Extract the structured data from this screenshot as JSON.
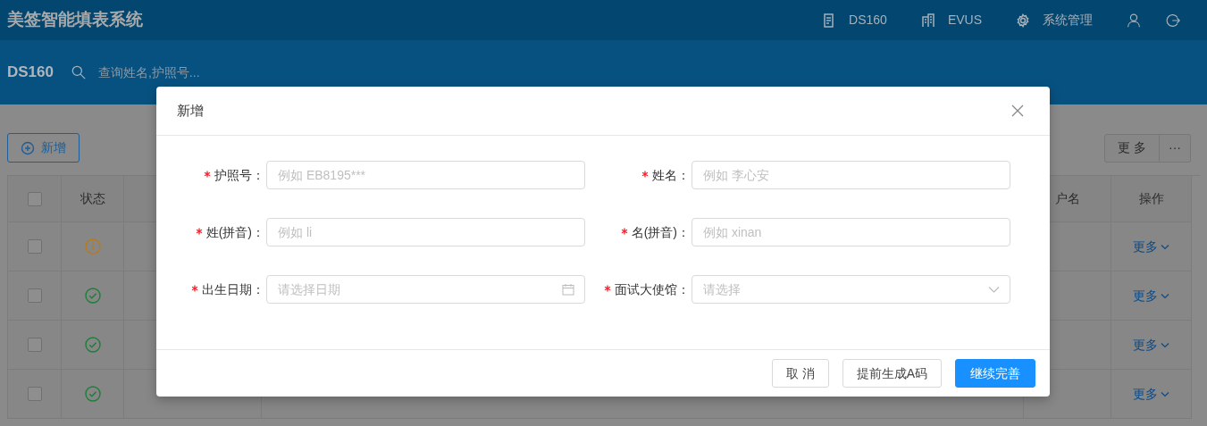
{
  "header": {
    "title": "美签智能填表系统",
    "nav": [
      {
        "label": "DS160"
      },
      {
        "label": "EVUS"
      },
      {
        "label": "系统管理"
      }
    ]
  },
  "subheader": {
    "title": "DS160",
    "search": {
      "placeholder": "查询姓名,护照号..."
    }
  },
  "toolbar": {
    "add_button": "新增",
    "more_button": "更 多",
    "ellipsis_button": "···"
  },
  "table": {
    "select_all_checked": false,
    "columns": [
      {},
      {
        "label": "状态"
      },
      {},
      {},
      {
        "label": "户名"
      },
      {
        "label": "操作"
      }
    ],
    "rows": [
      {
        "checked": false,
        "kind": "warning",
        "action": "更多"
      },
      {
        "checked": false,
        "kind": "ok",
        "action": "更多"
      },
      {
        "checked": false,
        "kind": "ok",
        "action": "更多"
      },
      {
        "checked": false,
        "kind": "ok",
        "action": "更多"
      }
    ]
  },
  "modal": {
    "title": "新增",
    "fields": [
      {
        "label": "护照号：",
        "required": true,
        "placeholder": "例如 EB8195***",
        "kind": "text"
      },
      {
        "label": "姓名：",
        "required": true,
        "placeholder": "例如 李心安",
        "kind": "text"
      },
      {
        "label": "姓(拼音)：",
        "required": true,
        "placeholder": "例如 li",
        "kind": "text"
      },
      {
        "label": "名(拼音)：",
        "required": true,
        "placeholder": "例如 xinan",
        "kind": "text"
      },
      {
        "label": "出生日期：",
        "required": true,
        "placeholder": "请选择日期",
        "kind": "date"
      },
      {
        "label": "面试大使馆：",
        "required": true,
        "placeholder": "请选择",
        "kind": "select"
      }
    ],
    "buttons": [
      {
        "label": "取 消",
        "kind": "default"
      },
      {
        "label": "提前生成A码",
        "kind": "default"
      },
      {
        "label": "继续完善",
        "kind": "primary"
      }
    ]
  }
}
